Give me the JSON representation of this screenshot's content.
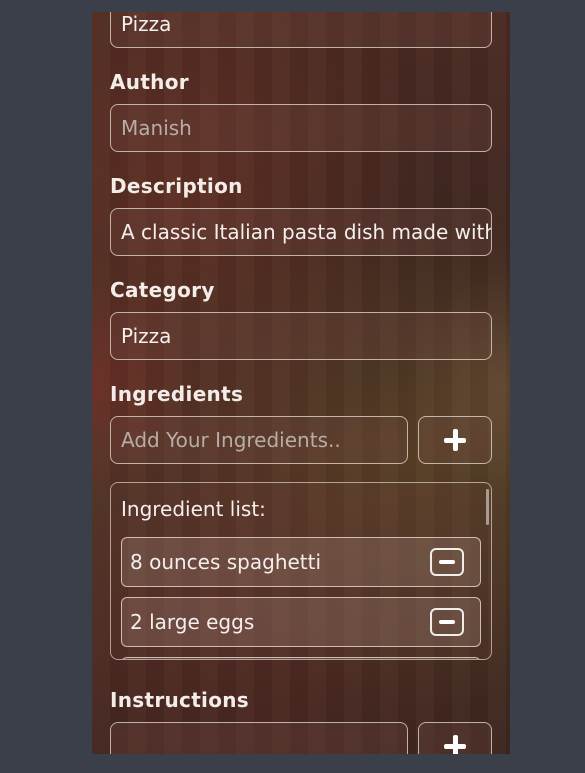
{
  "recipe_name": {
    "value": "Pizza"
  },
  "author": {
    "label": "Author",
    "placeholder": "Manish"
  },
  "description": {
    "label": "Description",
    "value": "A classic Italian pasta dish made with"
  },
  "category": {
    "label": "Category",
    "value": "Pizza"
  },
  "ingredients": {
    "label": "Ingredients",
    "input_placeholder": "Add Your Ingredients..",
    "list_title": "Ingredient list:",
    "items": [
      "8 ounces spaghetti",
      "2 large eggs"
    ]
  },
  "instructions": {
    "label": "Instructions"
  },
  "icons": {
    "add": "plus-icon",
    "remove": "minus-icon"
  }
}
